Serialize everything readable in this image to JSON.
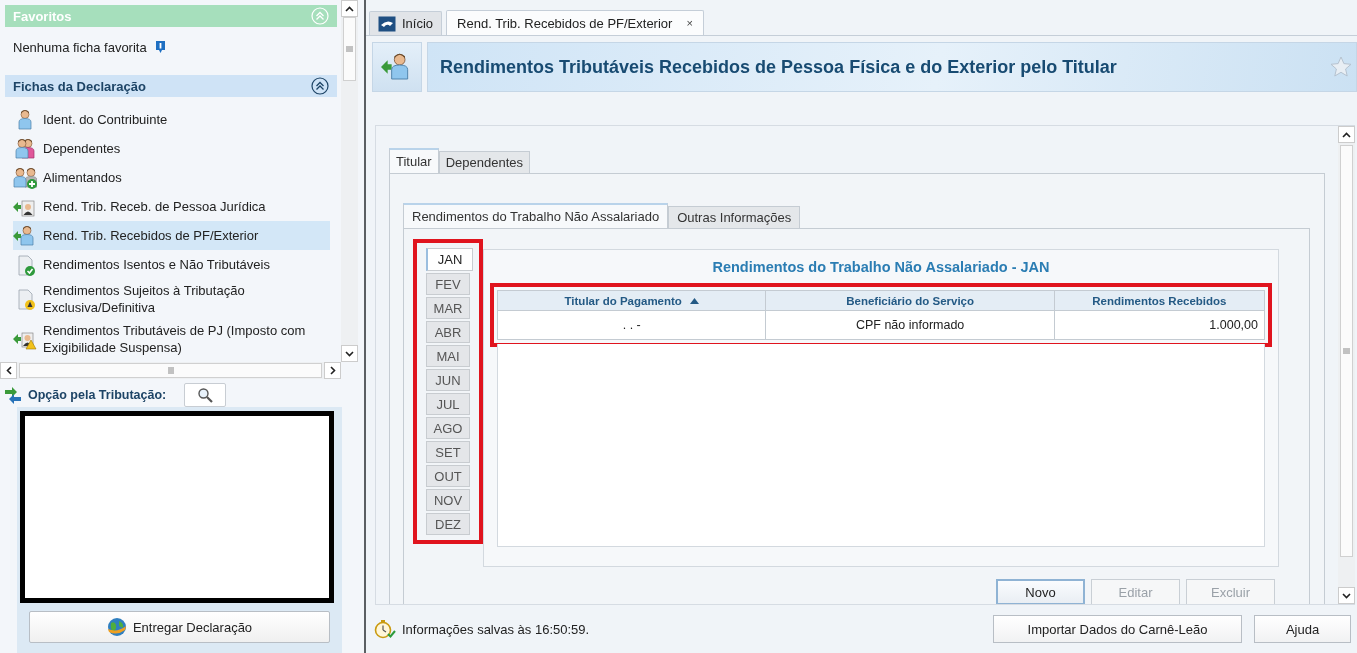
{
  "favorites": {
    "title": "Favoritos",
    "expanded": true,
    "empty_text": "Nenhuma ficha favorita"
  },
  "forms_section": {
    "title": "Fichas da Declaração",
    "expanded": true
  },
  "forms": [
    {
      "label": "Ident. do Contribuinte",
      "kind": "person",
      "selected": false
    },
    {
      "label": "Dependentes",
      "kind": "couple",
      "selected": false
    },
    {
      "label": "Alimentandos",
      "kind": "person-add",
      "selected": false
    },
    {
      "label": "Rend. Trib. Receb. de Pessoa Jurídica",
      "kind": "arrow-badge",
      "selected": false
    },
    {
      "label": "Rend. Trib. Recebidos de PF/Exterior",
      "kind": "arrow-person",
      "selected": true
    },
    {
      "label": "Rendimentos Isentos e Não Tributáveis",
      "kind": "doc-check",
      "selected": false
    },
    {
      "label": "Rendimentos Sujeitos à Tributação Exclusiva/Definitiva",
      "kind": "doc-warn",
      "selected": false
    },
    {
      "label": "Rendimentos Tributáveis de PJ (Imposto com Exigibilidade Suspensa)",
      "kind": "arrow-warn",
      "selected": false
    }
  ],
  "tax_option": {
    "label": "Opção pela Tributação:"
  },
  "submit_button": "Entregar Declaração",
  "doc_tabs": [
    {
      "label": "Início",
      "kind": "home",
      "selected": false,
      "closable": false
    },
    {
      "label": "Rend. Trib. Recebidos de PF/Exterior",
      "kind": "page",
      "selected": true,
      "closable": true
    }
  ],
  "close_glyph": "×",
  "page_title": "Rendimentos Tributáveis Recebidos de Pessoa Física e do Exterior pelo Titular",
  "person_tabs": [
    {
      "label": "Titular",
      "selected": true
    },
    {
      "label": "Dependentes",
      "selected": false
    }
  ],
  "section_tabs": [
    {
      "label": "Rendimentos do Trabalho Não Assalariado",
      "selected": true
    },
    {
      "label": "Outras Informações",
      "selected": false
    }
  ],
  "months_highlighted": true,
  "months": [
    {
      "label": "JAN",
      "selected": true
    },
    {
      "label": "FEV",
      "selected": false
    },
    {
      "label": "MAR",
      "selected": false
    },
    {
      "label": "ABR",
      "selected": false
    },
    {
      "label": "MAI",
      "selected": false
    },
    {
      "label": "JUN",
      "selected": false
    },
    {
      "label": "JUL",
      "selected": false
    },
    {
      "label": "AGO",
      "selected": false
    },
    {
      "label": "SET",
      "selected": false
    },
    {
      "label": "OUT",
      "selected": false
    },
    {
      "label": "NOV",
      "selected": false
    },
    {
      "label": "DEZ",
      "selected": false
    }
  ],
  "panel_title": "Rendimentos do Trabalho Não Assalariado - JAN",
  "table": {
    "highlighted": true,
    "columns": [
      {
        "label": "Titular do Pagamento",
        "sorted": true,
        "numeric": false
      },
      {
        "label": "Beneficiário do Serviço",
        "sorted": false,
        "numeric": false
      },
      {
        "label": "Rendimentos Recebidos",
        "sorted": false,
        "numeric": true
      }
    ],
    "rows": [
      [
        ". . -",
        "CPF não informado",
        "1.000,00"
      ]
    ]
  },
  "actions": [
    {
      "label": "Novo",
      "disabled": false
    },
    {
      "label": "Editar",
      "disabled": true
    },
    {
      "label": "Excluir",
      "disabled": true
    }
  ],
  "status": {
    "text": "Informações salvas às 16:50:59."
  },
  "footer_buttons": [
    {
      "label": "Importar Dados do Carnê-Leão"
    },
    {
      "label": "Ajuda"
    }
  ]
}
